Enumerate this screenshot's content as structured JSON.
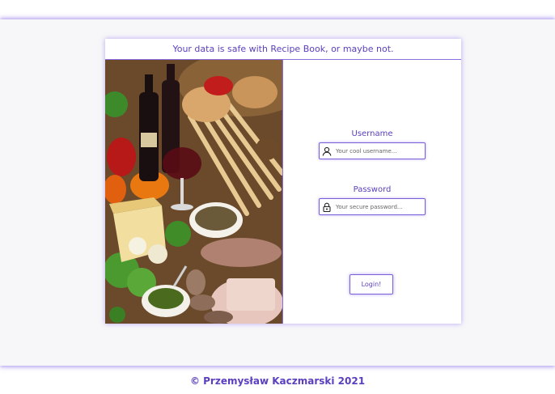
{
  "header": {
    "tagline": "Your data is safe with Recipe Book, or maybe not."
  },
  "login_form": {
    "username_label": "Username",
    "username_placeholder": "Your cool username...",
    "username_icon": "user-icon",
    "password_label": "Password",
    "password_placeholder": "Your secure password...",
    "password_icon": "lock-icon",
    "login_button": "Login!"
  },
  "footer": {
    "copyright": "© Przemysław Kaczmarski 2021"
  },
  "colors": {
    "accent": "#5b3fbf",
    "border": "#8c6ee0",
    "band": "#f7f7f9"
  }
}
